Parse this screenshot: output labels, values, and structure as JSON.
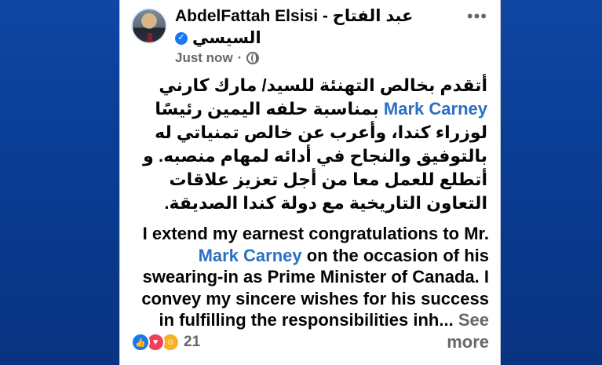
{
  "post": {
    "author_line1": "AbdelFattah Elsisi - عبد الفتاح",
    "author_line2": "السيسي",
    "time": "Just now",
    "arabic_before_mention": "أتقدم بخالص التهنئة للسيد/ مارك كارني ",
    "arabic_mention": "Mark Carney",
    "arabic_after_mention": " بمناسبة حلفه اليمين رئيسًا لوزراء كندا، وأعرب عن خالص تمنياتي له بالتوفيق والنجاح في أدائه لمهام منصبه. و أتطلع للعمل معا من أجل تعزيز علاقات التعاون التاريخية مع دولة كندا الصديقة.",
    "english_before_mention": "I extend my earnest congratulations to Mr. ",
    "english_mention": "Mark Carney",
    "english_after_mention": "  on the occasion of his swearing-in as Prime Minister of Canada. I convey my sincere wishes for his success in fulfilling the responsibilities inh...",
    "see_more": "See more",
    "reaction_count": "21",
    "reactions": [
      "like-icon",
      "love-icon",
      "care-icon"
    ]
  },
  "icons": {
    "more": "more-options-icon",
    "verified": "verified-badge-icon",
    "audience": "globe-icon"
  },
  "colors": {
    "mention": "#2b71c1",
    "background": "#0b3a8c",
    "like": "#1877f2",
    "love": "#f33e58",
    "care": "#f7b125"
  }
}
